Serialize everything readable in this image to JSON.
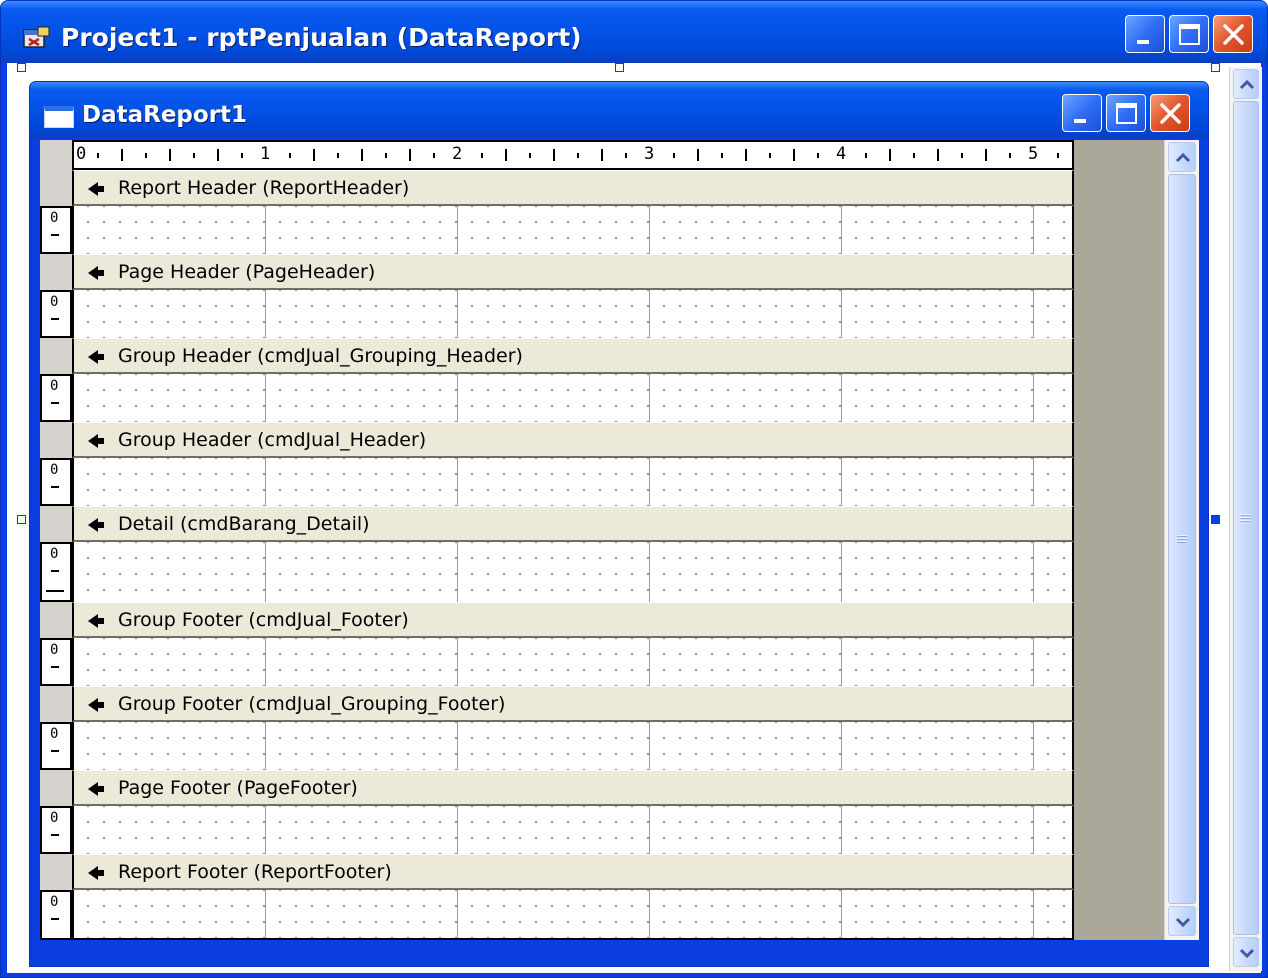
{
  "outer_window": {
    "title": "Project1 - rptPenjualan (DataReport)"
  },
  "report_window": {
    "title": "DataReport1"
  },
  "ruler": {
    "numbers": [
      "0",
      "1",
      "2",
      "3",
      "4",
      "5"
    ]
  },
  "sections": [
    {
      "label": "Report Header (ReportHeader)",
      "margin_value": "0"
    },
    {
      "label": "Page Header (PageHeader)",
      "margin_value": "0"
    },
    {
      "label": "Group Header (cmdJual_Grouping_Header)",
      "margin_value": "0"
    },
    {
      "label": "Group Header (cmdJual_Header)",
      "margin_value": "0"
    },
    {
      "label": "Detail (cmdBarang_Detail)",
      "margin_value": "0"
    },
    {
      "label": "Group Footer (cmdJual_Footer)",
      "margin_value": "0"
    },
    {
      "label": "Group Footer (cmdJual_Grouping_Footer)",
      "margin_value": "0"
    },
    {
      "label": "Page Footer (PageFooter)",
      "margin_value": "0"
    },
    {
      "label": "Report Footer (ReportFooter)",
      "margin_value": "0"
    }
  ],
  "icons": {
    "app": "project-app-icon",
    "document": "data-report-icon",
    "minimize": "minimize-icon",
    "maximize": "maximize-icon",
    "close": "close-icon",
    "scroll_up": "chevron-up-icon",
    "scroll_down": "chevron-down-icon",
    "section_arrow": "section-arrow-icon"
  },
  "colors": {
    "titlebar": "#0a5af0",
    "close_button": "#e2542b",
    "section_bar": "#ece9d8",
    "workspace": "#aca899"
  }
}
